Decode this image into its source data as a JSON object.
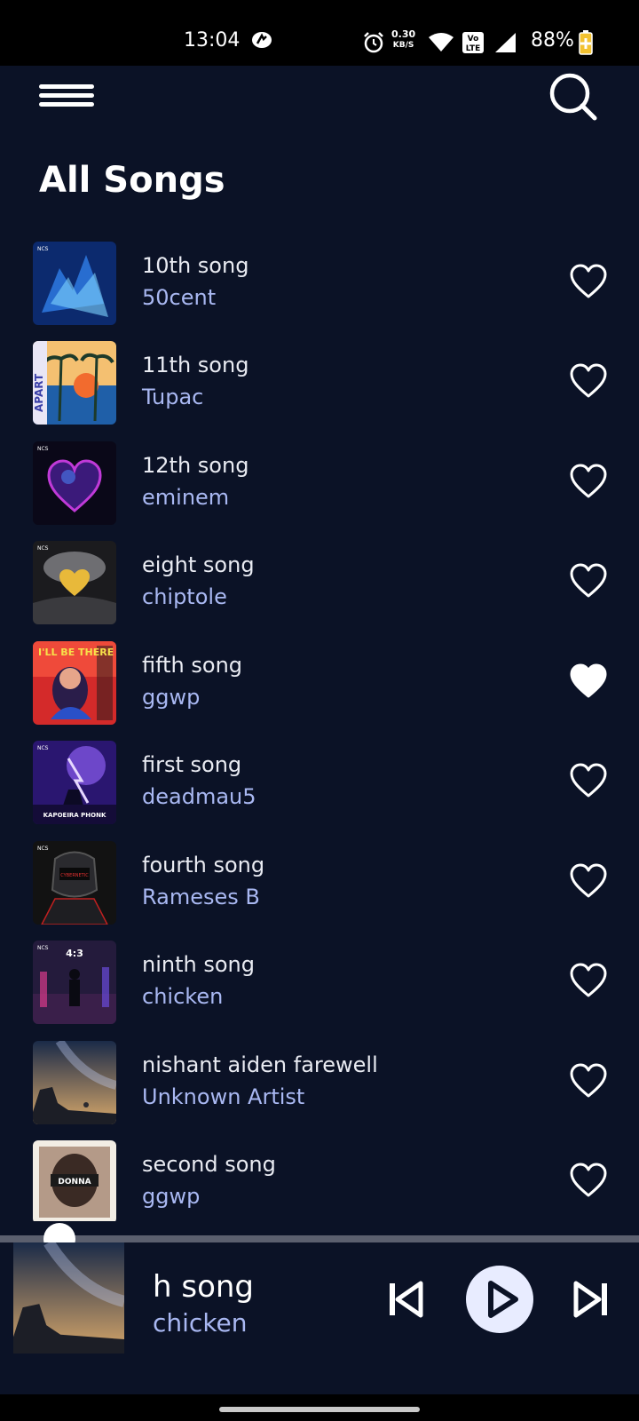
{
  "status_bar": {
    "time": "13:04",
    "speed_value": "0.30",
    "speed_unit": "KB/S",
    "battery": "88%",
    "icons": [
      "app-notification-icon",
      "alarm-icon",
      "wifi-icon",
      "volte-icon",
      "signal-icon",
      "battery-charging-icon"
    ]
  },
  "header": {
    "menu_icon": "hamburger-menu-icon",
    "search_icon": "search-icon",
    "title": "All Songs"
  },
  "songs": [
    {
      "title": "10th song",
      "artist": "50cent",
      "favorite": false
    },
    {
      "title": "11th song",
      "artist": "Tupac",
      "favorite": false
    },
    {
      "title": "12th song",
      "artist": "eminem",
      "favorite": false
    },
    {
      "title": "eight song",
      "artist": "chiptole",
      "favorite": false
    },
    {
      "title": "fifth song",
      "artist": "ggwp",
      "favorite": true
    },
    {
      "title": "first song",
      "artist": "deadmau5",
      "favorite": false
    },
    {
      "title": "fourth song",
      "artist": "Rameses B",
      "favorite": false
    },
    {
      "title": "ninth song",
      "artist": "chicken",
      "favorite": false
    },
    {
      "title": "nishant aiden farewell",
      "artist": "Unknown Artist",
      "favorite": false
    },
    {
      "title": "second song",
      "artist": "ggwp",
      "favorite": false
    }
  ],
  "now_playing": {
    "title": "h song",
    "artist": "chicken",
    "progress_fraction": 0.04,
    "controls": [
      "previous-icon",
      "play-icon",
      "next-icon"
    ]
  },
  "colors": {
    "background": "#0b1226",
    "artist_text": "#a9b8f2",
    "play_button": "#e8ecff"
  }
}
